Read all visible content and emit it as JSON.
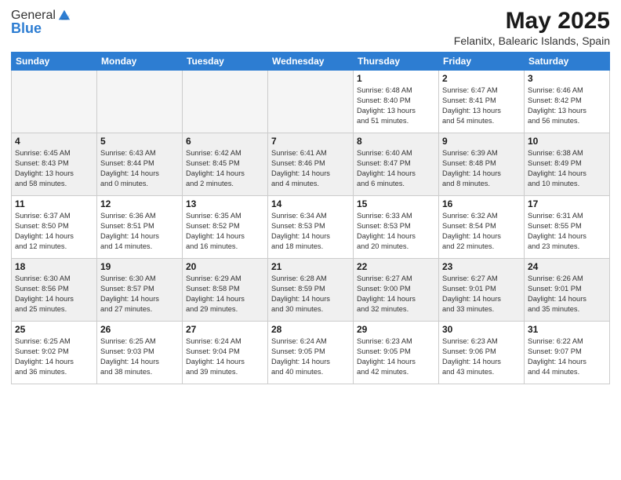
{
  "header": {
    "logo_general": "General",
    "logo_blue": "Blue",
    "month_title": "May 2025",
    "location": "Felanitx, Balearic Islands, Spain"
  },
  "weekdays": [
    "Sunday",
    "Monday",
    "Tuesday",
    "Wednesday",
    "Thursday",
    "Friday",
    "Saturday"
  ],
  "weeks": [
    {
      "shaded": false,
      "days": [
        {
          "num": "",
          "info": ""
        },
        {
          "num": "",
          "info": ""
        },
        {
          "num": "",
          "info": ""
        },
        {
          "num": "",
          "info": ""
        },
        {
          "num": "1",
          "info": "Sunrise: 6:48 AM\nSunset: 8:40 PM\nDaylight: 13 hours\nand 51 minutes."
        },
        {
          "num": "2",
          "info": "Sunrise: 6:47 AM\nSunset: 8:41 PM\nDaylight: 13 hours\nand 54 minutes."
        },
        {
          "num": "3",
          "info": "Sunrise: 6:46 AM\nSunset: 8:42 PM\nDaylight: 13 hours\nand 56 minutes."
        }
      ]
    },
    {
      "shaded": true,
      "days": [
        {
          "num": "4",
          "info": "Sunrise: 6:45 AM\nSunset: 8:43 PM\nDaylight: 13 hours\nand 58 minutes."
        },
        {
          "num": "5",
          "info": "Sunrise: 6:43 AM\nSunset: 8:44 PM\nDaylight: 14 hours\nand 0 minutes."
        },
        {
          "num": "6",
          "info": "Sunrise: 6:42 AM\nSunset: 8:45 PM\nDaylight: 14 hours\nand 2 minutes."
        },
        {
          "num": "7",
          "info": "Sunrise: 6:41 AM\nSunset: 8:46 PM\nDaylight: 14 hours\nand 4 minutes."
        },
        {
          "num": "8",
          "info": "Sunrise: 6:40 AM\nSunset: 8:47 PM\nDaylight: 14 hours\nand 6 minutes."
        },
        {
          "num": "9",
          "info": "Sunrise: 6:39 AM\nSunset: 8:48 PM\nDaylight: 14 hours\nand 8 minutes."
        },
        {
          "num": "10",
          "info": "Sunrise: 6:38 AM\nSunset: 8:49 PM\nDaylight: 14 hours\nand 10 minutes."
        }
      ]
    },
    {
      "shaded": false,
      "days": [
        {
          "num": "11",
          "info": "Sunrise: 6:37 AM\nSunset: 8:50 PM\nDaylight: 14 hours\nand 12 minutes."
        },
        {
          "num": "12",
          "info": "Sunrise: 6:36 AM\nSunset: 8:51 PM\nDaylight: 14 hours\nand 14 minutes."
        },
        {
          "num": "13",
          "info": "Sunrise: 6:35 AM\nSunset: 8:52 PM\nDaylight: 14 hours\nand 16 minutes."
        },
        {
          "num": "14",
          "info": "Sunrise: 6:34 AM\nSunset: 8:53 PM\nDaylight: 14 hours\nand 18 minutes."
        },
        {
          "num": "15",
          "info": "Sunrise: 6:33 AM\nSunset: 8:53 PM\nDaylight: 14 hours\nand 20 minutes."
        },
        {
          "num": "16",
          "info": "Sunrise: 6:32 AM\nSunset: 8:54 PM\nDaylight: 14 hours\nand 22 minutes."
        },
        {
          "num": "17",
          "info": "Sunrise: 6:31 AM\nSunset: 8:55 PM\nDaylight: 14 hours\nand 23 minutes."
        }
      ]
    },
    {
      "shaded": true,
      "days": [
        {
          "num": "18",
          "info": "Sunrise: 6:30 AM\nSunset: 8:56 PM\nDaylight: 14 hours\nand 25 minutes."
        },
        {
          "num": "19",
          "info": "Sunrise: 6:30 AM\nSunset: 8:57 PM\nDaylight: 14 hours\nand 27 minutes."
        },
        {
          "num": "20",
          "info": "Sunrise: 6:29 AM\nSunset: 8:58 PM\nDaylight: 14 hours\nand 29 minutes."
        },
        {
          "num": "21",
          "info": "Sunrise: 6:28 AM\nSunset: 8:59 PM\nDaylight: 14 hours\nand 30 minutes."
        },
        {
          "num": "22",
          "info": "Sunrise: 6:27 AM\nSunset: 9:00 PM\nDaylight: 14 hours\nand 32 minutes."
        },
        {
          "num": "23",
          "info": "Sunrise: 6:27 AM\nSunset: 9:01 PM\nDaylight: 14 hours\nand 33 minutes."
        },
        {
          "num": "24",
          "info": "Sunrise: 6:26 AM\nSunset: 9:01 PM\nDaylight: 14 hours\nand 35 minutes."
        }
      ]
    },
    {
      "shaded": false,
      "days": [
        {
          "num": "25",
          "info": "Sunrise: 6:25 AM\nSunset: 9:02 PM\nDaylight: 14 hours\nand 36 minutes."
        },
        {
          "num": "26",
          "info": "Sunrise: 6:25 AM\nSunset: 9:03 PM\nDaylight: 14 hours\nand 38 minutes."
        },
        {
          "num": "27",
          "info": "Sunrise: 6:24 AM\nSunset: 9:04 PM\nDaylight: 14 hours\nand 39 minutes."
        },
        {
          "num": "28",
          "info": "Sunrise: 6:24 AM\nSunset: 9:05 PM\nDaylight: 14 hours\nand 40 minutes."
        },
        {
          "num": "29",
          "info": "Sunrise: 6:23 AM\nSunset: 9:05 PM\nDaylight: 14 hours\nand 42 minutes."
        },
        {
          "num": "30",
          "info": "Sunrise: 6:23 AM\nSunset: 9:06 PM\nDaylight: 14 hours\nand 43 minutes."
        },
        {
          "num": "31",
          "info": "Sunrise: 6:22 AM\nSunset: 9:07 PM\nDaylight: 14 hours\nand 44 minutes."
        }
      ]
    }
  ]
}
